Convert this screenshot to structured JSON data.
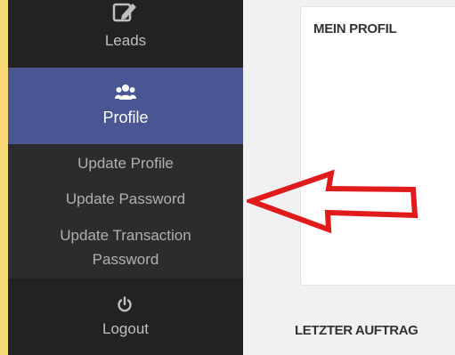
{
  "sidebar": {
    "leads_label": "Leads",
    "leads_icon": "edit-icon",
    "profile_label": "Profile",
    "profile_icon": "users-icon",
    "submenu": [
      {
        "label": "Update Profile"
      },
      {
        "label": "Update Password"
      },
      {
        "label": "Update Transaction Password"
      }
    ],
    "logout_label": "Logout",
    "logout_icon": "power-icon"
  },
  "main": {
    "profile_card_title": "MEIN PROFIL",
    "last_order_title": "LETZTER AUFTRAG"
  },
  "annotation": {
    "arrow_icon": "red-arrow-left-icon",
    "arrow_color": "#e01b1b"
  },
  "colors": {
    "page_background": "#f9d978",
    "sidebar_background": "#222222",
    "active_item_background": "#495693"
  }
}
